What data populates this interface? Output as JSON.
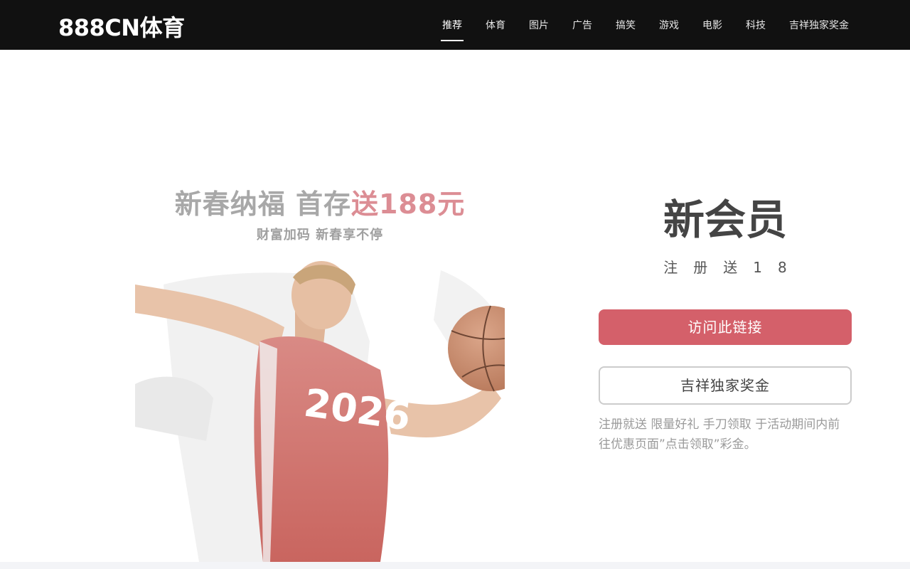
{
  "header": {
    "brand": "888CN体育",
    "nav": [
      {
        "label": "推荐",
        "active": true
      },
      {
        "label": "体育"
      },
      {
        "label": "图片"
      },
      {
        "label": "广告"
      },
      {
        "label": "搞笑"
      },
      {
        "label": "游戏"
      },
      {
        "label": "电影"
      },
      {
        "label": "科技"
      },
      {
        "label": "吉祥独家奖金"
      }
    ]
  },
  "hero": {
    "promo_title_part1": "新春纳福 首存",
    "promo_title_highlight": "送188元",
    "promo_subtitle": "财富加码 新春享不停",
    "jersey_number": "2026",
    "accent_color": "#d4606a"
  },
  "side": {
    "title": "新会员",
    "subtitle": "注册送18",
    "primary_button": "访问此链接",
    "secondary_button": "吉祥独家奖金",
    "description": "注册就送 限量好礼 手刀领取 于活动期间内前往优惠页面”点击领取”彩金。"
  }
}
